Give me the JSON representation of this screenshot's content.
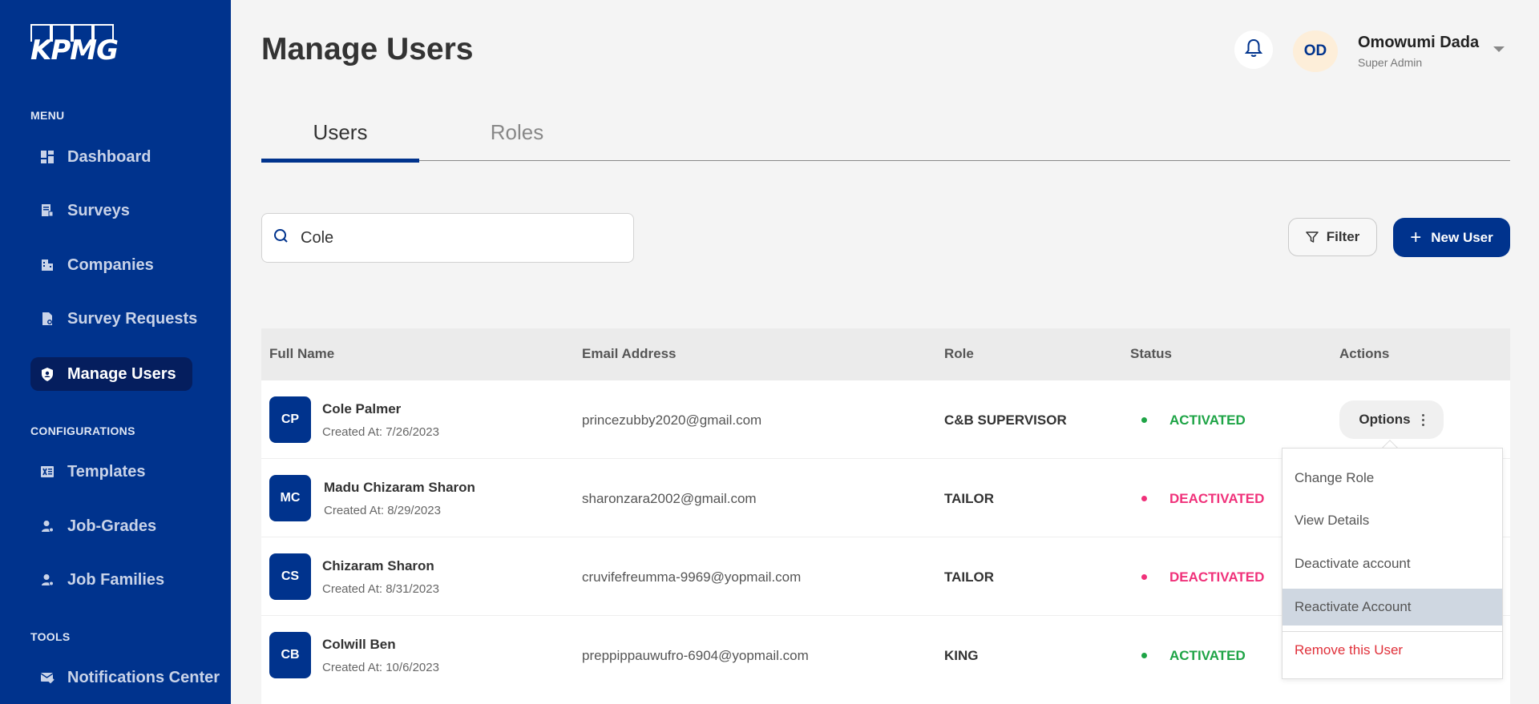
{
  "brand": {
    "logo_text": "KPMG"
  },
  "sidebar": {
    "sections": {
      "menu": "MENU",
      "configurations": "CONFIGURATIONS",
      "tools": "TOOLS"
    },
    "items": [
      {
        "label": "Dashboard",
        "icon": "dashboard-icon"
      },
      {
        "label": "Surveys",
        "icon": "survey-icon"
      },
      {
        "label": "Companies",
        "icon": "building-icon"
      },
      {
        "label": "Survey Requests",
        "icon": "document-icon"
      },
      {
        "label": "Manage Users",
        "icon": "shield-user-icon",
        "active": true
      },
      {
        "label": "Templates",
        "icon": "excel-icon"
      },
      {
        "label": "Job-Grades",
        "icon": "user-star-icon"
      },
      {
        "label": "Job Families",
        "icon": "user-star-icon"
      },
      {
        "label": "Notifications Center",
        "icon": "mail-check-icon"
      }
    ]
  },
  "header": {
    "title": "Manage Users",
    "user": {
      "initials": "OD",
      "name": "Omowumi Dada",
      "role": "Super Admin"
    }
  },
  "tabs": [
    {
      "label": "Users",
      "active": true
    },
    {
      "label": "Roles",
      "active": false
    }
  ],
  "toolbar": {
    "search_value": "Cole",
    "search_placeholder": "Search",
    "filter_label": "Filter",
    "new_user_label": "New User"
  },
  "table": {
    "columns": [
      "Full Name",
      "Email Address",
      "Role",
      "Status",
      "Actions"
    ],
    "options_label": "Options",
    "rows": [
      {
        "initials": "CP",
        "name": "Cole Palmer",
        "created": "Created At: 7/26/2023",
        "email": "princezubby2020@gmail.com",
        "role": "C&B SUPERVISOR",
        "status": "ACTIVATED"
      },
      {
        "initials": "MC",
        "name": "Madu Chizaram Sharon",
        "created": "Created At: 8/29/2023",
        "email": "sharonzara2002@gmail.com",
        "role": "TAILOR",
        "status": "DEACTIVATED"
      },
      {
        "initials": "CS",
        "name": "Chizaram Sharon",
        "created": "Created At: 8/31/2023",
        "email": "cruvifefreumma-9969@yopmail.com",
        "role": "TAILOR",
        "status": "DEACTIVATED"
      },
      {
        "initials": "CB",
        "name": "Colwill Ben",
        "created": "Created At: 10/6/2023",
        "email": "preppippauwufro-6904@yopmail.com",
        "role": "KING",
        "status": "ACTIVATED"
      }
    ]
  },
  "options_menu": {
    "items": [
      "Change Role",
      "View Details",
      "Deactivate account",
      "Reactivate Account",
      "Remove this User"
    ],
    "highlighted": "Reactivate Account"
  },
  "colors": {
    "brand": "#00338d",
    "activated": "#1ea446",
    "deactivated": "#f0317a",
    "danger": "#e0303a"
  }
}
